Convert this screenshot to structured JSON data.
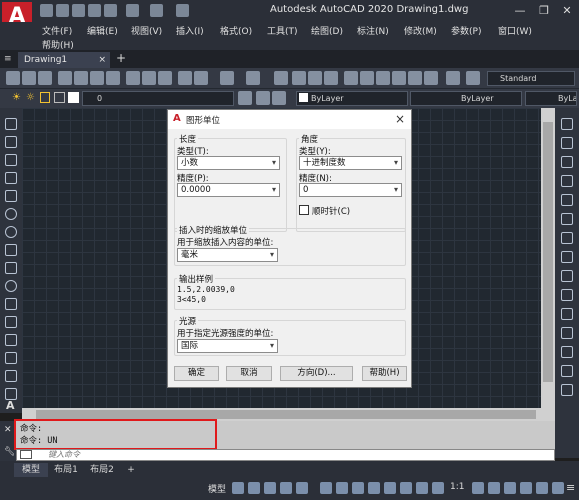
{
  "titlebar": {
    "app_letter": "A",
    "title": "Autodesk AutoCAD 2020    Drawing1.dwg"
  },
  "menu": [
    "文件(F)",
    "编辑(E)",
    "视图(V)",
    "插入(I)",
    "格式(O)",
    "工具(T)",
    "绘图(D)",
    "标注(N)",
    "修改(M)",
    "参数(P)",
    "窗口(W)",
    "帮助(H)"
  ],
  "tabs": {
    "drawing": "Drawing1",
    "close": "×",
    "add": "+"
  },
  "toolbar": {
    "style_combo": "Standard",
    "layer_value": "0",
    "color_combo": "ByLayer",
    "linetype_combo": "ByLayer",
    "lineweight_combo": "ByLa"
  },
  "dialog": {
    "title": "图形单位",
    "close": "×",
    "length": {
      "group": "长度",
      "type_label": "类型(T):",
      "type_value": "小数",
      "precision_label": "精度(P):",
      "precision_value": "0.0000"
    },
    "angle": {
      "group": "角度",
      "type_label": "类型(Y):",
      "type_value": "十进制度数",
      "precision_label": "精度(N):",
      "precision_value": "0",
      "clockwise_label": "顺时针(C)"
    },
    "insertion": {
      "group": "插入时的缩放单位",
      "label": "用于缩放插入内容的单位:",
      "value": "毫米"
    },
    "sample": {
      "group": "输出样例",
      "line1": "1.5,2.0039,0",
      "line2": "3<45,0"
    },
    "lighting": {
      "group": "光源",
      "label": "用于指定光源强度的单位:",
      "value": "国际"
    },
    "buttons": {
      "ok": "确定",
      "cancel": "取消",
      "direction": "方向(D)...",
      "help": "帮助(H)"
    }
  },
  "command": {
    "history": [
      "命令:",
      "命令: UN"
    ],
    "placeholder": "键入命令"
  },
  "layout_tabs": [
    "模型",
    "布局1",
    "布局2",
    "+"
  ],
  "status": {
    "model": "模型",
    "scale": "1:1"
  }
}
